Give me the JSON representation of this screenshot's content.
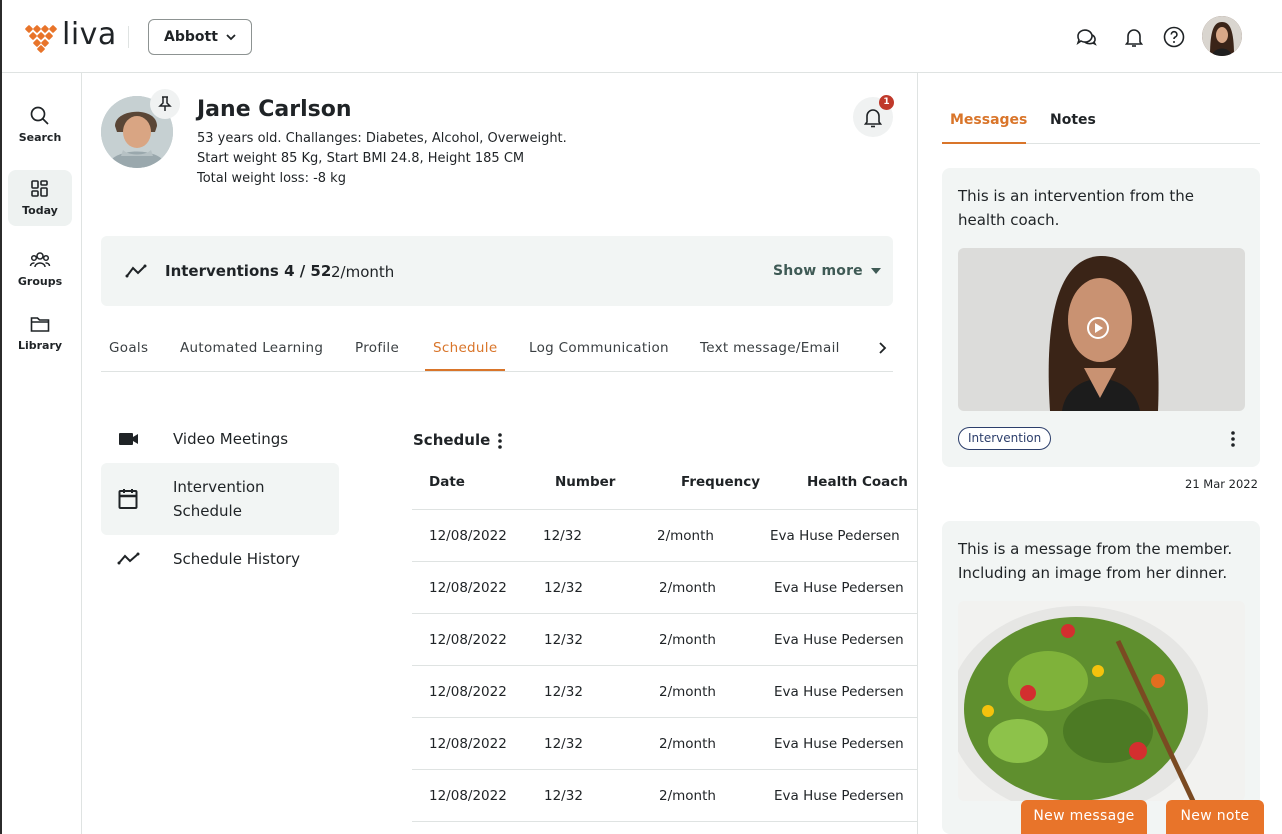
{
  "header": {
    "logo_text": "liva",
    "org_select": "Abbott",
    "accent_color": "#e8742a"
  },
  "leftnav": {
    "items": [
      {
        "label": "Search",
        "icon": "search-icon"
      },
      {
        "label": "Today",
        "icon": "dashboard-icon"
      },
      {
        "label": "Groups",
        "icon": "groups-icon"
      },
      {
        "label": "Library",
        "icon": "folder-icon"
      }
    ]
  },
  "profile": {
    "name": "Jane Carlson",
    "line1": "53 years old. Challanges: Diabetes, Alcohol, Overweight.",
    "line2": "Start weight 85 Kg, Start BMI 24.8, Height 185 CM",
    "line3": "Total weight loss: -8 kg",
    "notification_count": "1"
  },
  "interventions": {
    "title": "Interventions 4 / 52",
    "frequency": "2/month",
    "show_more": "Show more"
  },
  "tabs": [
    "Goals",
    "Automated Learning",
    "Profile",
    "Schedule",
    "Log Communication",
    "Text message/Email"
  ],
  "schedule_menu": {
    "video": "Video Meetings",
    "intervention_line1": "Intervention",
    "intervention_line2": "Schedule",
    "history": "Schedule History"
  },
  "schedule_table": {
    "title": "Schedule",
    "columns": [
      "Date",
      "Number",
      "Frequency",
      "Health Coach"
    ],
    "rows": [
      [
        "12/08/2022",
        "12/32",
        "2/month",
        "Eva Huse Pedersen"
      ],
      [
        "12/08/2022",
        "12/32",
        "2/month",
        "Eva Huse Pedersen"
      ],
      [
        "12/08/2022",
        "12/32",
        "2/month",
        "Eva Huse Pedersen"
      ],
      [
        "12/08/2022",
        "12/32",
        "2/month",
        "Eva Huse Pedersen"
      ],
      [
        "12/08/2022",
        "12/32",
        "2/month",
        "Eva Huse Pedersen"
      ],
      [
        "12/08/2022",
        "12/32",
        "2/month",
        "Eva Huse Pedersen"
      ]
    ]
  },
  "right_panel": {
    "tabs": [
      "Messages",
      "Notes"
    ],
    "card1": {
      "line1": "This is an intervention from the",
      "line2": "health coach.",
      "chip": "Intervention",
      "date": "21 Mar 2022"
    },
    "card2": {
      "line1": "This is a message from the member.",
      "line2": "Including an image from her dinner."
    },
    "new_message": "New message",
    "new_note": "New note"
  }
}
